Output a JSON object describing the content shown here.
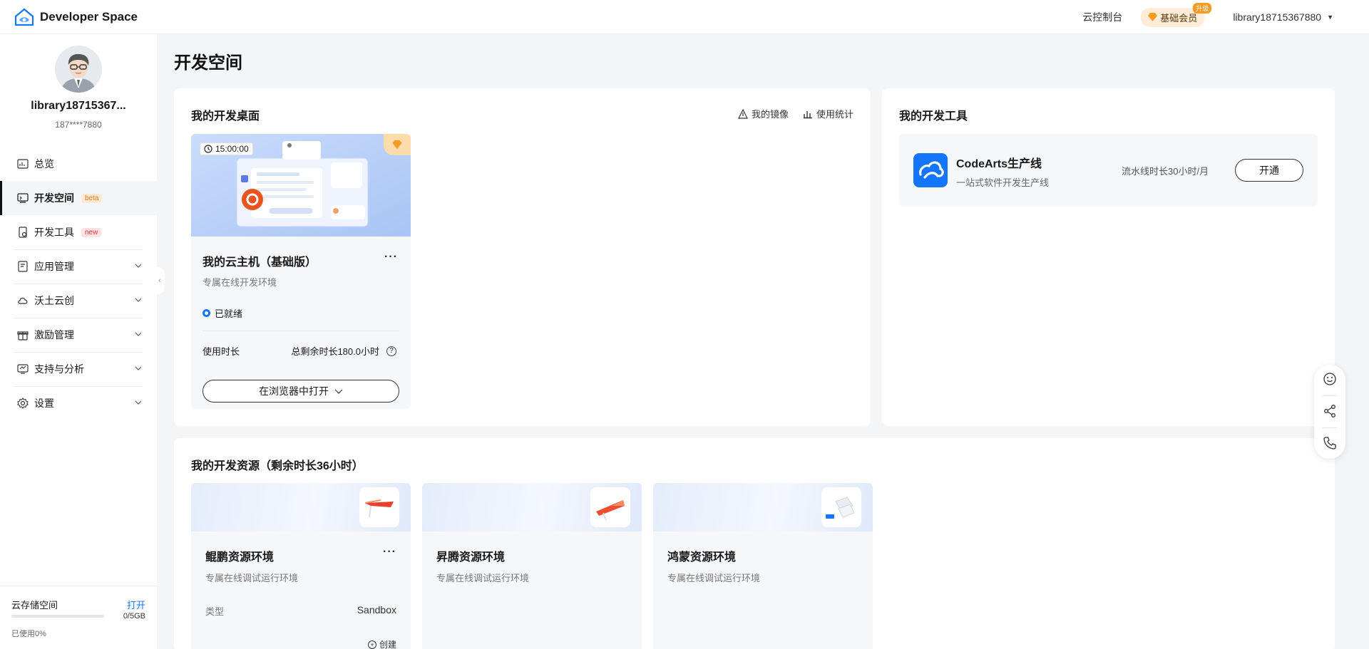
{
  "header": {
    "brand": "Developer Space",
    "console_link": "云控制台",
    "vip_label": "基础会员",
    "vip_badge": "升级",
    "username": "library18715367880"
  },
  "sidebar": {
    "display_name": "library18715367...",
    "phone": "187****7880",
    "items": [
      {
        "label": "总览",
        "icon": "overview-icon"
      },
      {
        "label": "开发空间",
        "tag": "beta",
        "icon": "dev-space-icon",
        "active": true
      },
      {
        "label": "开发工具",
        "tag": "new",
        "icon": "dev-tools-icon"
      },
      {
        "label": "应用管理",
        "icon": "app-manage-icon",
        "expandable": true
      },
      {
        "label": "沃土云创",
        "icon": "cloud-icon",
        "expandable": true
      },
      {
        "label": "激励管理",
        "icon": "gift-icon",
        "expandable": true
      },
      {
        "label": "支持与分析",
        "icon": "support-icon",
        "expandable": true
      },
      {
        "label": "设置",
        "icon": "gear-icon",
        "expandable": true
      }
    ],
    "storage": {
      "title": "云存储空间",
      "action": "打开",
      "size": "0/5GB",
      "used": "已使用0%",
      "used_fraction": 0
    }
  },
  "main": {
    "page_title": "开发空间",
    "desktop": {
      "title": "我的开发桌面",
      "actions": [
        "我的镜像",
        "使用统计"
      ],
      "vm": {
        "timer": "15:00:00",
        "name": "我的云主机（基础版）",
        "more": "···",
        "desc": "专属在线开发环境",
        "status": "已就绪",
        "usage_label": "使用时长",
        "usage_value": "总剩余时长180.0小时",
        "help": "?",
        "open_button": "在浏览器中打开"
      }
    },
    "tools": {
      "title": "我的开发工具",
      "item": {
        "name": "CodeArts生产线",
        "desc": "一站式软件开发生产线",
        "quota": "流水线时长30小时/月",
        "button": "开通"
      }
    },
    "resources": {
      "title": "我的开发资源（剩余时长36小时）",
      "items": [
        {
          "name": "鲲鹏资源环境",
          "desc": "专属在线调试运行环境",
          "more": "···",
          "type_label": "类型",
          "type_value": "Sandbox",
          "create": "创建"
        },
        {
          "name": "昇腾资源环境",
          "desc": "专属在线调试运行环境"
        },
        {
          "name": "鸿蒙资源环境",
          "desc": "专属在线调试运行环境"
        }
      ]
    }
  },
  "float_bar": [
    "smile-icon",
    "share-icon",
    "phone-icon"
  ],
  "colors": {
    "accent": "#1476ff",
    "vip": "#f59a23",
    "background": "#f4f5f7"
  }
}
